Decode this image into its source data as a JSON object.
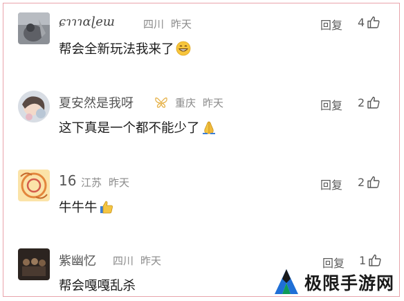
{
  "comments": [
    {
      "username": "ɕɿɿɿɑɭeɯ",
      "location": "四川",
      "time": "昨天",
      "text": "帮会全新玩法我来了",
      "emoji": "grinning-face",
      "reply_label": "回复",
      "like_count": "4"
    },
    {
      "username": "夏安然是我呀",
      "location": "重庆",
      "time": "昨天",
      "text": "这下真是一个都不能少了",
      "emoji": "folded-hands",
      "reply_label": "回复",
      "like_count": "2"
    },
    {
      "username": "16",
      "location": "江苏",
      "time": "昨天",
      "text": "牛牛牛",
      "emoji": "thumbs-up",
      "reply_label": "回复",
      "like_count": "2"
    },
    {
      "username": "紫幽忆",
      "location": "四川",
      "time": "昨天",
      "text": "帮会嘎嘎乱杀",
      "emoji": "",
      "reply_label": "回复",
      "like_count": "1"
    }
  ],
  "watermark": {
    "text": "极限手游网"
  },
  "colors": {
    "border": "#e8a3aa",
    "meta": "#8a8a8a",
    "text": "#1c1c1c"
  }
}
